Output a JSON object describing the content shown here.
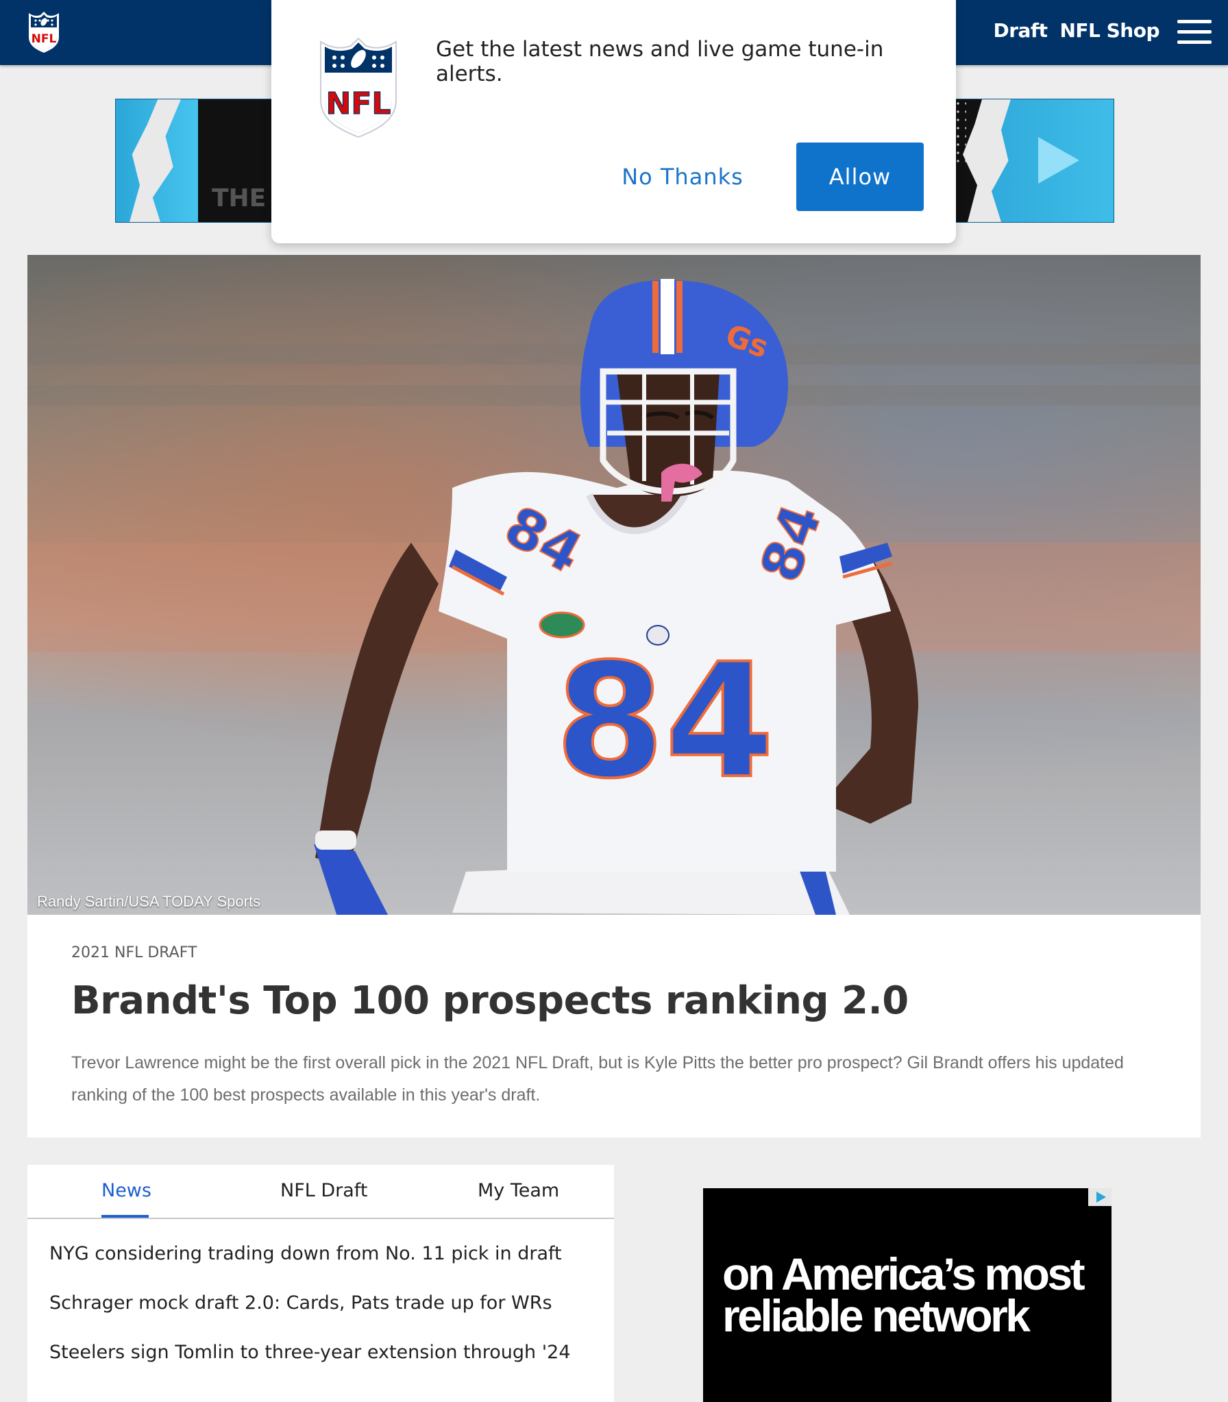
{
  "nav": {
    "links": [
      "Draft",
      "NFL Shop"
    ]
  },
  "banner_ad": {
    "partial_text": "THE I"
  },
  "notification": {
    "message": "Get the latest news and live game tune-in alerts.",
    "no_thanks_label": "No Thanks",
    "allow_label": "Allow"
  },
  "hero": {
    "photo_credit": "Randy Sartin/USA TODAY Sports",
    "jersey_number": "84",
    "kicker": "2021 NFL DRAFT",
    "headline": "Brandt's Top 100 prospects ranking 2.0",
    "summary": "Trevor Lawrence might be the first overall pick in the 2021 NFL Draft, but is Kyle Pitts the better pro prospect? Gil Brandt offers his updated ranking of the 100 best prospects available in this year's draft."
  },
  "news_panel": {
    "tabs": [
      "News",
      "NFL Draft",
      "My Team"
    ],
    "active_tab": "News",
    "items": [
      "NYG considering trading down from No. 11 pick in draft",
      "Schrager mock draft 2.0: Cards, Pats trade up for WRs",
      "Steelers sign Tomlin to three-year extension through '24"
    ]
  },
  "side_ad": {
    "line1": "on America’s most",
    "line2": "reliable network"
  },
  "colors": {
    "nav_background": "#013369",
    "allow_button": "#0f73cc",
    "active_tab": "#1d5fd1",
    "nfl_red": "#d50a0a"
  },
  "icons": [
    "nfl-shield-icon",
    "hamburger-menu-icon",
    "adchoices-icon"
  ]
}
